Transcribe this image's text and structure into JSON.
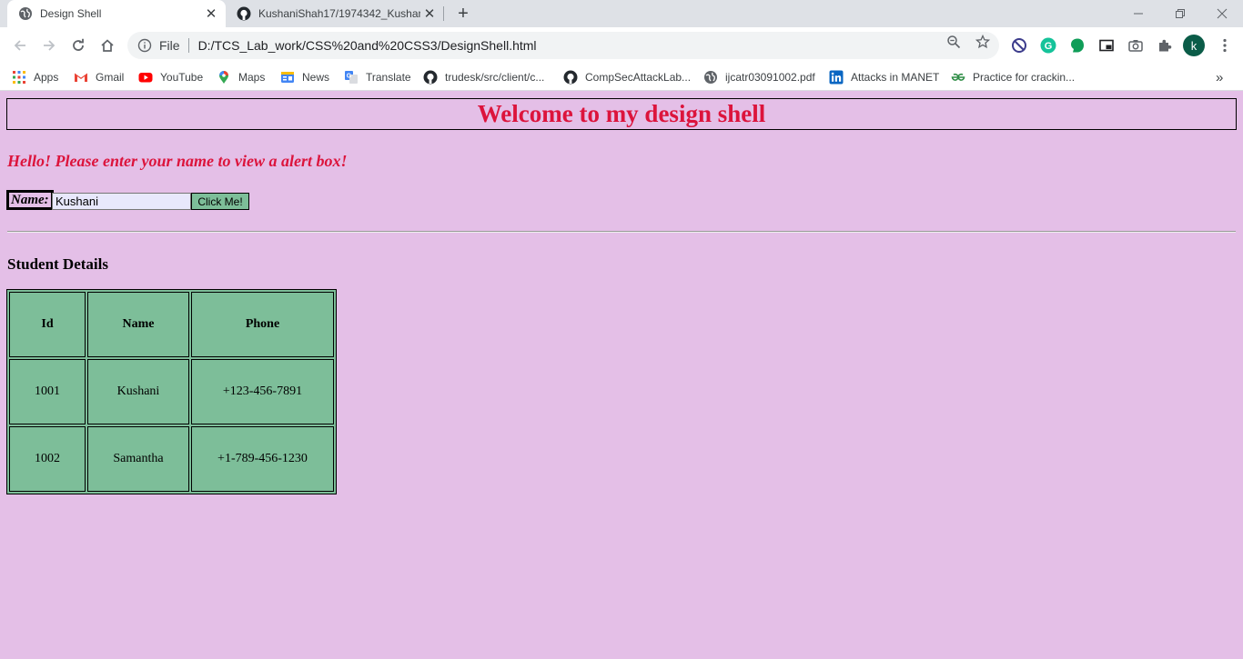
{
  "browser": {
    "active_tab": {
      "title": "Design Shell",
      "favicon": "globe-icon"
    },
    "inactive_tab": {
      "title": "KushaniShah17/1974342_KushaniShah",
      "favicon": "github-icon"
    },
    "omnibox": {
      "scheme": "File",
      "url": "D:/TCS_Lab_work/CSS%20and%20CSS3/DesignShell.html"
    },
    "profile_initial": "k",
    "bookmarks": [
      {
        "label": "Apps",
        "icon": "apps-grid-icon"
      },
      {
        "label": "Gmail",
        "icon": "gmail-icon"
      },
      {
        "label": "YouTube",
        "icon": "youtube-icon"
      },
      {
        "label": "Maps",
        "icon": "maps-pin-icon"
      },
      {
        "label": "News",
        "icon": "news-icon"
      },
      {
        "label": "Translate",
        "icon": "translate-icon"
      },
      {
        "label": "trudesk/src/client/c...",
        "icon": "github-icon"
      },
      {
        "label": "CompSecAttackLab...",
        "icon": "github-icon"
      },
      {
        "label": "ijcatr03091002.pdf",
        "icon": "globe-icon"
      },
      {
        "label": "Attacks in MANET",
        "icon": "linkedin-icon"
      },
      {
        "label": "Practice for crackin...",
        "icon": "gfg-icon"
      }
    ],
    "overflow": "»",
    "colors": {
      "tabstrip": "#dee1e6",
      "toolbar": "#ffffff",
      "omnibox": "#f1f3f4"
    }
  },
  "page": {
    "heading": "Welcome to my design shell",
    "greeting": "Hello! Please enter your name to view a alert box!",
    "name_label": "Name:",
    "name_value": "Kushani",
    "button_label": "Click Me!",
    "section_title": "Student Details",
    "table": {
      "headers": [
        "Id",
        "Name",
        "Phone"
      ],
      "rows": [
        [
          "1001",
          "Kushani",
          "+123-456-7891"
        ],
        [
          "1002",
          "Samantha",
          "+1-789-456-1230"
        ]
      ]
    },
    "colors": {
      "background": "#e4bfe7",
      "heading_text": "#dc143c",
      "table_cell": "#7dbe99",
      "button": "#7dbe99",
      "input": "#e8e8fc"
    }
  }
}
